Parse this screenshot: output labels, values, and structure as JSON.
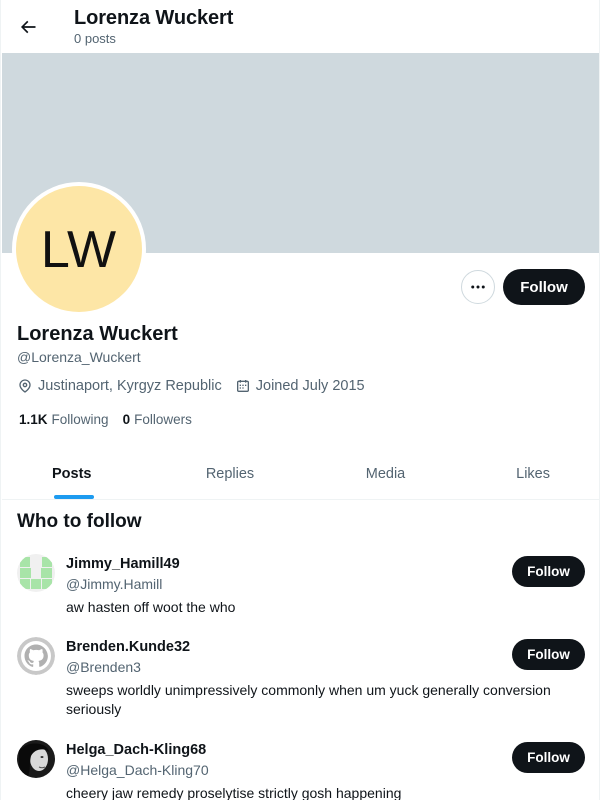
{
  "header": {
    "title": "Lorenza Wuckert",
    "subtitle": "0 posts"
  },
  "profile": {
    "avatar_initials": "LW",
    "avatar_color": "#fde6a6",
    "banner_color": "#cfd9de",
    "name": "Lorenza Wuckert",
    "handle": "@Lorenza_Wuckert",
    "location": "Justinaport, Kyrgyz Republic",
    "joined": "Joined July 2015",
    "following_count": "1.1K",
    "following_label": "Following",
    "followers_count": "0",
    "followers_label": "Followers",
    "follow_label": "Follow",
    "more_icon": "more-dots-icon"
  },
  "tabs": [
    {
      "label": "Posts",
      "active": true
    },
    {
      "label": "Replies",
      "active": false
    },
    {
      "label": "Media",
      "active": false
    },
    {
      "label": "Likes",
      "active": false
    }
  ],
  "who_to_follow": {
    "title": "Who to follow",
    "items": [
      {
        "name": "Jimmy_Hamill49",
        "handle": "@Jimmy.Hamill",
        "bio": "aw hasten off woot the who",
        "follow_label": "Follow",
        "avatar_icon": "identicon-avatar"
      },
      {
        "name": "Brenden.Kunde32",
        "handle": "@Brenden3",
        "bio": "sweeps worldly unimpressively commonly when um yuck generally conversion seriously",
        "follow_label": "Follow",
        "avatar_icon": "octocat-avatar"
      },
      {
        "name": "Helga_Dach-Kling68",
        "handle": "@Helga_Dach-Kling70",
        "bio": "cheery jaw remedy proselytise strictly gosh happening",
        "follow_label": "Follow",
        "avatar_icon": "portrait-avatar"
      }
    ]
  },
  "colors": {
    "accent": "#1d9bf0",
    "button_dark": "#0f1419",
    "secondary_text": "#536471"
  }
}
